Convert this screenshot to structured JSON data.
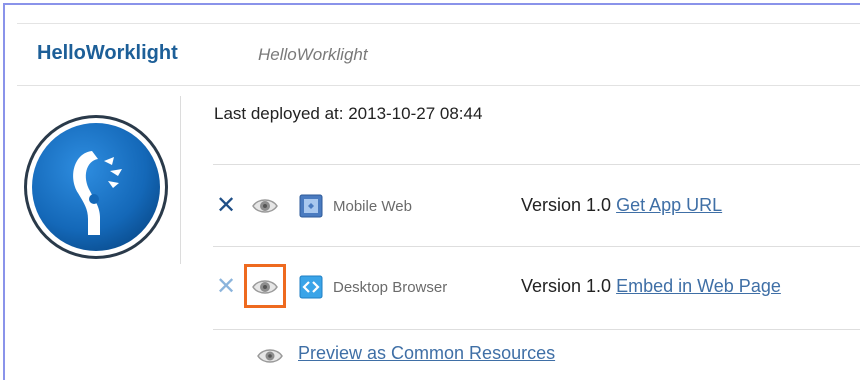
{
  "app": {
    "name": "HelloWorklight",
    "subtitle": "HelloWorklight"
  },
  "deployment": {
    "text": "Last deployed at: 2013-10-27 08:44"
  },
  "environments": [
    {
      "label": "Mobile Web",
      "version": "Version 1.0",
      "link": "Get App URL",
      "icon": "mobile-web-icon"
    },
    {
      "label": "Desktop Browser",
      "version": "Version 1.0",
      "link": "Embed in Web Page",
      "icon": "desktop-browser-icon"
    }
  ],
  "preview": {
    "link": "Preview as Common Resources"
  },
  "colors": {
    "title": "#1d5f98",
    "link": "#3f6fa6",
    "highlight": "#ee6a1f",
    "frame": "#8a93ea",
    "logo_blue": "#1a6fc0"
  }
}
